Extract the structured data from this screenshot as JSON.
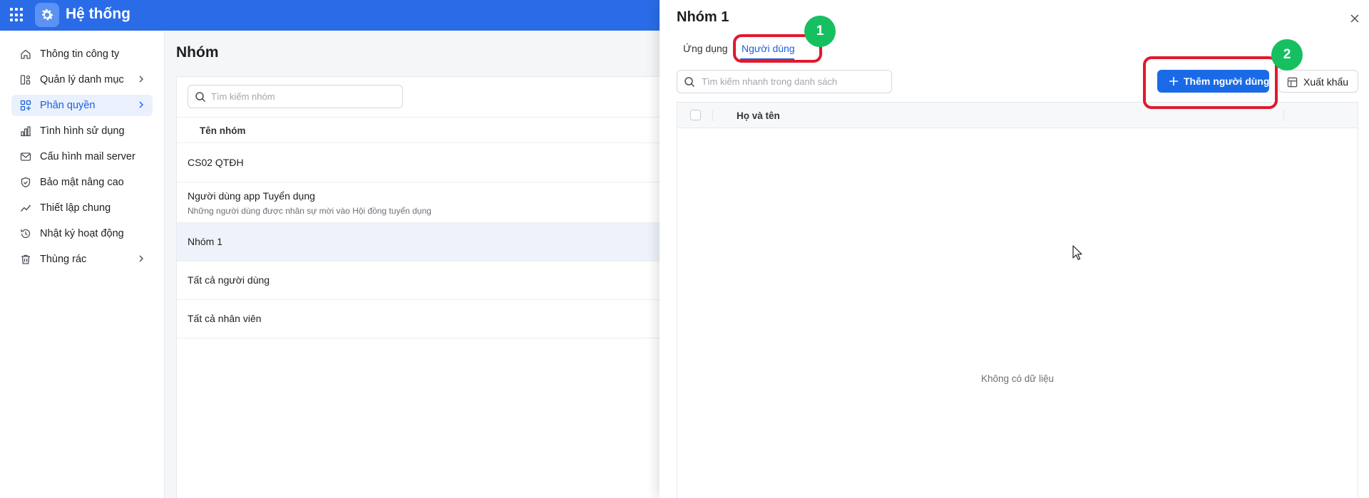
{
  "header": {
    "title": "Hệ thống",
    "apps_icon": "grid-icon",
    "logo_icon": "gear-icon"
  },
  "sidebar": {
    "items": [
      {
        "label": "Thông tin công ty",
        "icon": "home-icon",
        "has_children": false,
        "active": false
      },
      {
        "label": "Quản lý danh mục",
        "icon": "catalog-icon",
        "has_children": true,
        "active": false
      },
      {
        "label": "Phân quyền",
        "icon": "permission-icon",
        "has_children": true,
        "active": true
      },
      {
        "label": "Tình hình sử dụng",
        "icon": "bar-chart-icon",
        "has_children": false,
        "active": false
      },
      {
        "label": "Cấu hình mail server",
        "icon": "mail-icon",
        "has_children": false,
        "active": false
      },
      {
        "label": "Bảo mật nâng cao",
        "icon": "shield-icon",
        "has_children": false,
        "active": false
      },
      {
        "label": "Thiết lập chung",
        "icon": "trend-icon",
        "has_children": false,
        "active": false
      },
      {
        "label": "Nhật ký hoạt động",
        "icon": "history-icon",
        "has_children": false,
        "active": false
      },
      {
        "label": "Thùng rác",
        "icon": "trash-icon",
        "has_children": true,
        "active": false
      }
    ]
  },
  "groups_page": {
    "title": "Nhóm",
    "search_placeholder": "Tìm kiếm nhóm",
    "column_header": "Tên nhóm",
    "rows": [
      {
        "name": "CS02 QTĐH",
        "description": ""
      },
      {
        "name": "Người dùng app Tuyển dụng",
        "description": "Những người dùng được nhân sự mời vào Hội đồng tuyển dụng"
      },
      {
        "name": "Nhóm 1",
        "description": "",
        "selected": true
      },
      {
        "name": "Tất cả người dùng",
        "description": ""
      },
      {
        "name": "Tất cả nhân viên",
        "description": ""
      }
    ]
  },
  "drawer": {
    "title": "Nhóm 1",
    "tabs": [
      {
        "label": "Ứng dụng",
        "active": false
      },
      {
        "label": "Người dùng",
        "active": true
      }
    ],
    "search_placeholder": "Tìm kiếm nhanh trong danh sách",
    "add_button_label": "Thêm người dùng",
    "export_button_label": "Xuất khẩu",
    "table": {
      "column_name": "Họ và tên",
      "empty_text": "Không có dữ liệu"
    }
  },
  "annotations": [
    {
      "label": "1",
      "target": "Người dùng tab"
    },
    {
      "label": "2",
      "target": "Thêm người dùng button"
    }
  ],
  "colors": {
    "primary": "#1a6ae8",
    "topbar": "#2a6ce8",
    "highlight_box": "#e0192d",
    "badge": "#16c060"
  }
}
